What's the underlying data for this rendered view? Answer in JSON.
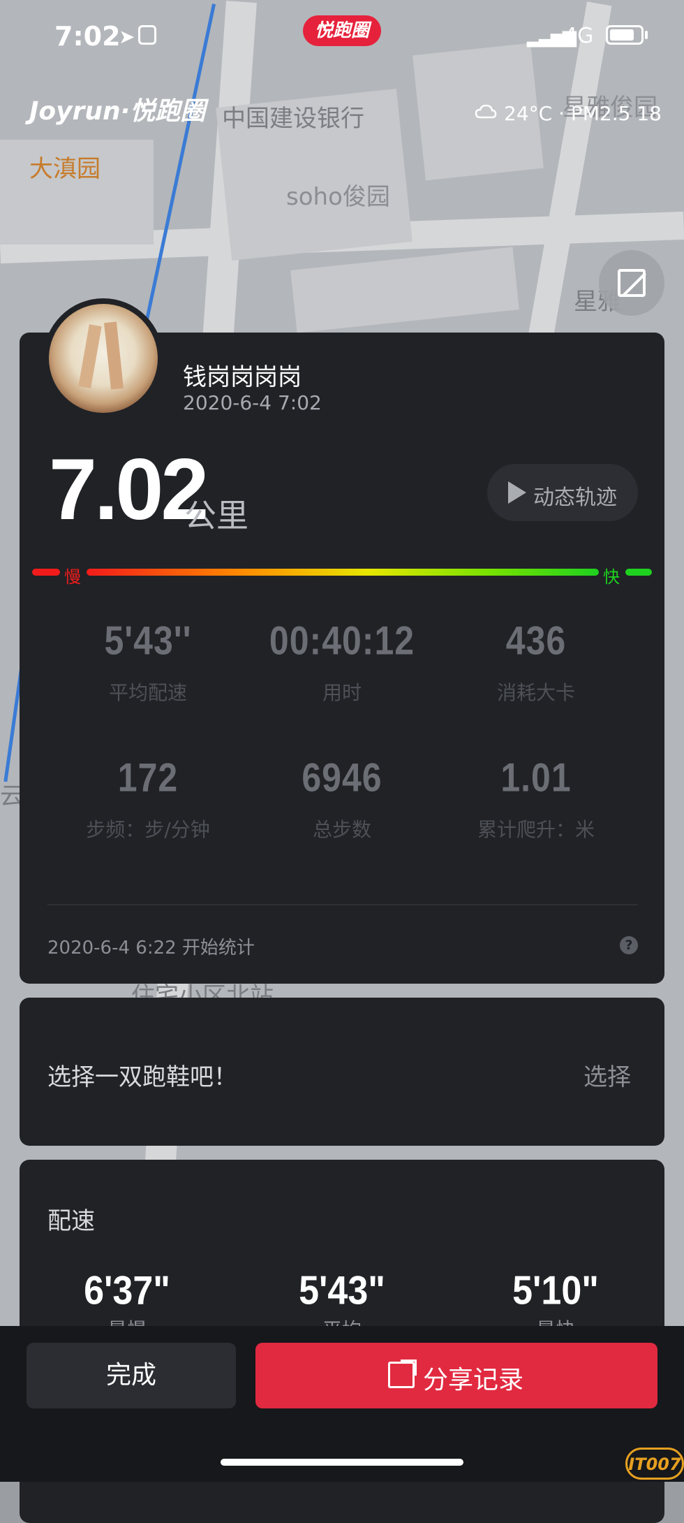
{
  "status_bar": {
    "time": "7:02",
    "network": "4G",
    "brand_pill": "悦跑圈"
  },
  "header": {
    "logo": "Joyrun·悦跑圈",
    "weather": "24°C · PM2.5 18"
  },
  "map_labels": [
    "大滇园",
    "中国建设银行",
    "soho俊园",
    "星雅俊园",
    "星雅",
    "住宅小区北站",
    "云"
  ],
  "run": {
    "user_name": "钱岗岗岗岗",
    "date_time": "2020-6-4 7:02",
    "distance": "7.02",
    "distance_unit": "公里",
    "track_button": "动态轨迹",
    "slow_label": "慢",
    "fast_label": "快",
    "stats": [
      {
        "value": "5'43''",
        "label": "平均配速"
      },
      {
        "value": "00:40:12",
        "label": "用时"
      },
      {
        "value": "436",
        "label": "消耗大卡"
      },
      {
        "value": "172",
        "label": "步频：步/分钟"
      },
      {
        "value": "6946",
        "label": "总步数"
      },
      {
        "value": "1.01",
        "label": "累计爬升：米"
      }
    ],
    "start_stat": "2020-6-4 6:22 开始统计"
  },
  "shoe": {
    "prompt": "选择一双跑鞋吧！",
    "select_label": "选择"
  },
  "pace": {
    "title": "配速",
    "items": [
      {
        "value": "6'37\"",
        "label": "最慢"
      },
      {
        "value": "5'43\"",
        "label": "平均"
      },
      {
        "value": "5'10\"",
        "label": "最快"
      }
    ]
  },
  "actions": {
    "done": "完成",
    "share": "分享记录"
  },
  "watermark": "IT007",
  "colors": {
    "accent": "#e12a40",
    "card": "#202226",
    "slow": "#f21b1b",
    "fast": "#1fd11f"
  }
}
